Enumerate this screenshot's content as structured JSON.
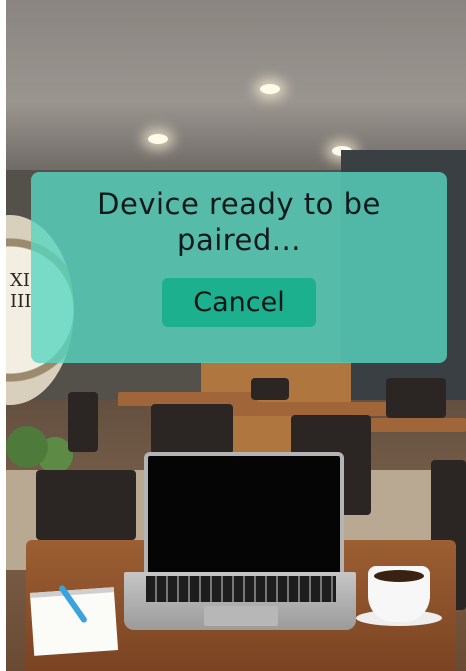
{
  "dialog": {
    "message": "Device ready to be paired...",
    "cancel_label": "Cancel"
  },
  "background": {
    "clock_numerals": "XI\nIII"
  },
  "colors": {
    "dialog_background": "#58d6c0",
    "cancel_button": "#1cb08f",
    "text": "#101a1a"
  }
}
